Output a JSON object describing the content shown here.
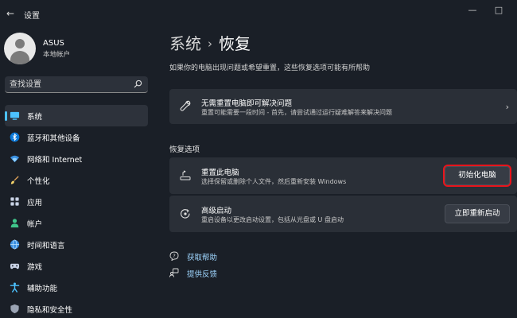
{
  "window": {
    "title": "设置",
    "back": "←",
    "minimize": "—",
    "maximize": "□"
  },
  "user": {
    "name": "ASUS",
    "account_type": "本地帐户"
  },
  "search": {
    "placeholder": "查找设置"
  },
  "sidebar": {
    "items": [
      {
        "label": "系统",
        "icon": "monitor-icon",
        "active": true
      },
      {
        "label": "蓝牙和其他设备",
        "icon": "bluetooth-icon"
      },
      {
        "label": "网络和 Internet",
        "icon": "wifi-icon"
      },
      {
        "label": "个性化",
        "icon": "brush-icon"
      },
      {
        "label": "应用",
        "icon": "apps-icon"
      },
      {
        "label": "帐户",
        "icon": "person-icon"
      },
      {
        "label": "时间和语言",
        "icon": "globe-icon"
      },
      {
        "label": "游戏",
        "icon": "gamepad-icon"
      },
      {
        "label": "辅助功能",
        "icon": "accessibility-icon"
      },
      {
        "label": "隐私和安全性",
        "icon": "shield-icon"
      }
    ]
  },
  "header": {
    "breadcrumb_parent": "系统",
    "separator": "›",
    "title": "恢复",
    "description": "如果你的电脑出现问题或希望重置，这些恢复选项可能有所帮助"
  },
  "fix_card": {
    "title": "无需重置电脑即可解决问题",
    "subtitle": "重置可能需要一段时间 - 首先，请尝试通过运行疑难解答来解决问题",
    "chevron": "›"
  },
  "recovery_section": {
    "label": "恢复选项",
    "reset": {
      "title": "重置此电脑",
      "subtitle": "选择保留或删除个人文件，然后重新安装 Windows",
      "button": "初始化电脑"
    },
    "advanced": {
      "title": "高级启动",
      "subtitle": "重启设备以更改启动设置，包括从光盘或 U 盘启动",
      "button": "立即重新启动"
    }
  },
  "links": {
    "help": "获取帮助",
    "feedback": "提供反馈"
  },
  "colors": {
    "accent": "#4cc2ff",
    "highlight_border": "#e8141b",
    "background": "#1a1f27",
    "card": "#2a2f37"
  }
}
